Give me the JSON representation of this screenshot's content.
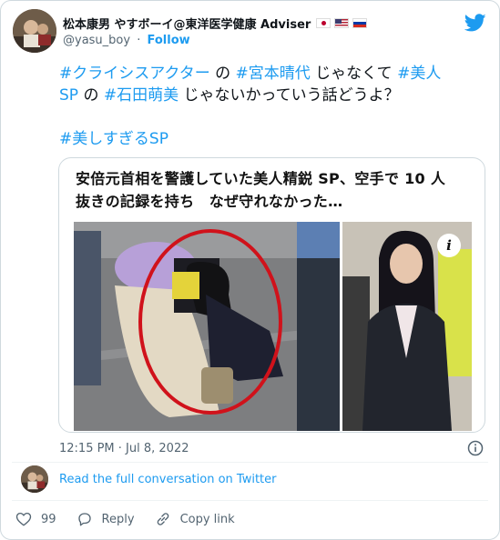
{
  "header": {
    "display_name": "松本康男 やすボーイ@東洋医学健康 Adviser",
    "handle": "@yasu_boy",
    "separator": "·",
    "follow_label": "Follow",
    "flags": [
      "japan-flag",
      "usa-flag",
      "russia-flag"
    ]
  },
  "tweet": {
    "line1": [
      {
        "text": "#クライシスアクター",
        "hashtag": true
      },
      {
        "text": " の ",
        "hashtag": false
      },
      {
        "text": "#宮本晴代",
        "hashtag": true
      },
      {
        "text": " じゃなくて ",
        "hashtag": false
      },
      {
        "text": "#美人",
        "hashtag": true
      }
    ],
    "line2": [
      {
        "text": "SP",
        "hashtag": true
      },
      {
        "text": " の ",
        "hashtag": false
      },
      {
        "text": "#石田萌美",
        "hashtag": true
      },
      {
        "text": " じゃないかっていう話どうよ？",
        "hashtag": false
      }
    ],
    "second_paragraph": "#美しすぎるSP"
  },
  "link_card": {
    "headline_line1": "安倍元首相を警護していた美人精鋭 SP、空手で 10 人",
    "headline_line2": "抜きの記録を持ち　なぜ守れなかった…",
    "info_badge": "i"
  },
  "footer": {
    "timestamp": "12:15 PM · Jul 8, 2022",
    "read_conversation": "Read the full conversation on Twitter",
    "like_count": "99",
    "reply_label": "Reply",
    "copy_link_label": "Copy link"
  },
  "colors": {
    "accent": "#1d9bf0",
    "text": "#0f1419",
    "muted": "#536471",
    "circle": "#d0121b"
  }
}
